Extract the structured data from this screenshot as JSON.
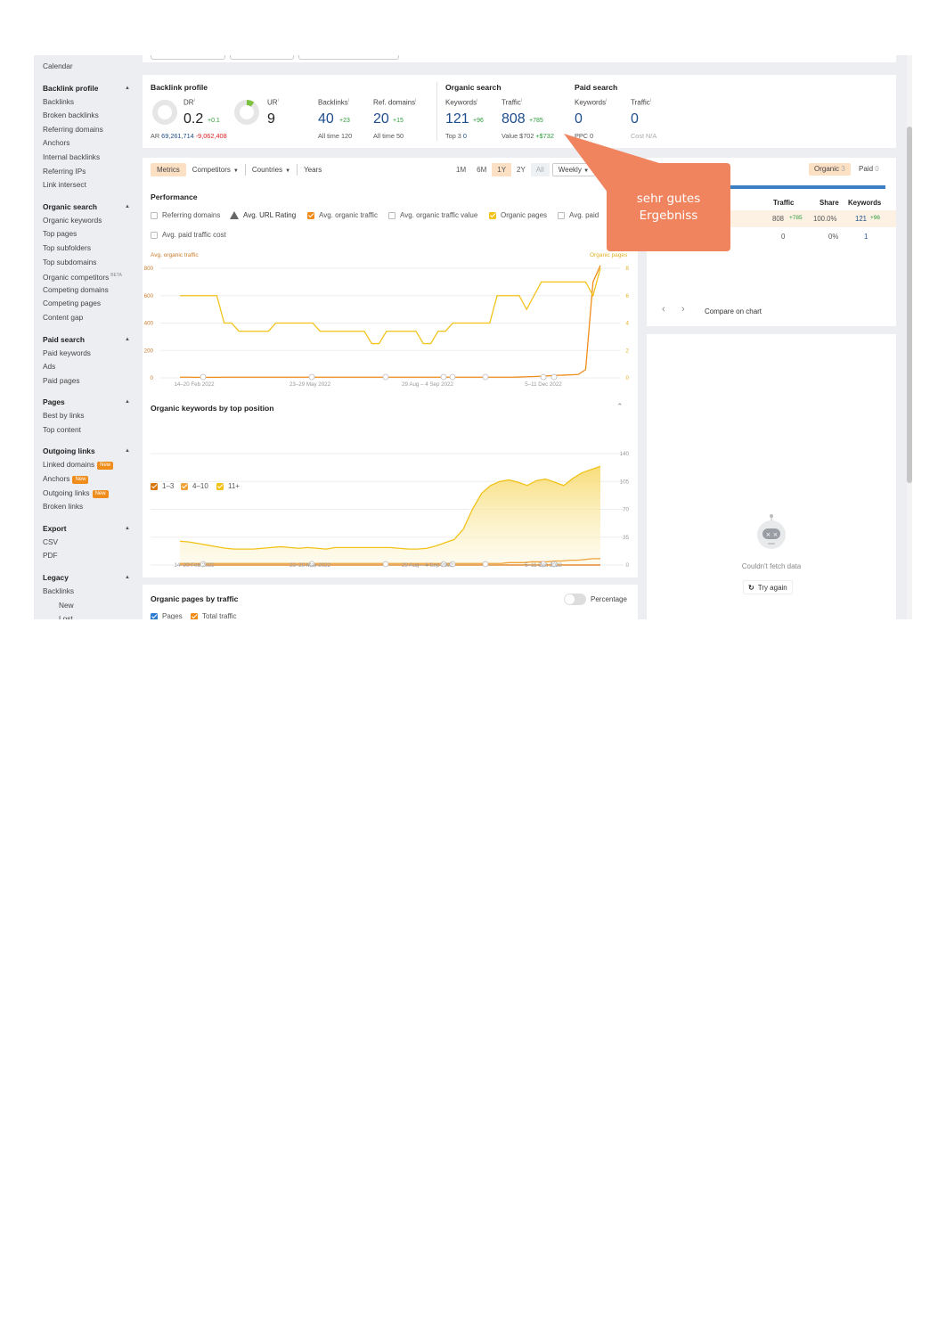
{
  "sidebar": {
    "top_item": "Calendar",
    "sections": [
      {
        "title": "Backlink profile",
        "items": [
          "Backlinks",
          "Broken backlinks",
          "Referring domains",
          "Anchors",
          "Internal backlinks",
          "Referring IPs",
          "Link intersect"
        ]
      },
      {
        "title": "Organic search",
        "items": [
          "Organic keywords",
          "Top pages",
          "Top subfolders",
          "Top subdomains",
          "Organic competitors",
          "Competing domains",
          "Competing pages",
          "Content gap"
        ],
        "beta_item": "Organic competitors",
        "beta_label": "BETA"
      },
      {
        "title": "Paid search",
        "items": [
          "Paid keywords",
          "Ads",
          "Paid pages"
        ]
      },
      {
        "title": "Pages",
        "items": [
          "Best by links",
          "Top content"
        ]
      },
      {
        "title": "Outgoing links",
        "items": [
          "Linked domains",
          "Anchors",
          "Outgoing links",
          "Broken links"
        ],
        "new_items": [
          "Linked domains",
          "Anchors",
          "Outgoing links"
        ],
        "new_label": "New"
      },
      {
        "title": "Export",
        "items": [
          "CSV",
          "PDF"
        ]
      },
      {
        "title": "Legacy",
        "items": [
          "Backlinks"
        ],
        "sub_items": [
          "New",
          "Lost"
        ]
      }
    ]
  },
  "metrics": {
    "backlink_profile": {
      "title": "Backlink profile",
      "dr": {
        "label": "DR",
        "value": "0.2",
        "delta": "+0.1",
        "ar_label": "AR",
        "ar_value": "69,261,714",
        "ar_delta": "-9,062,408",
        "ring_fill": 0.0
      },
      "ur": {
        "label": "UR",
        "value": "9",
        "ring_fill": 0.09
      },
      "backlinks": {
        "label": "Backlinks",
        "value": "40",
        "delta": "+23",
        "sub": "All time 120"
      },
      "ref_domains": {
        "label": "Ref. domains",
        "value": "20",
        "delta": "+15",
        "sub": "All time 50"
      }
    },
    "organic_search": {
      "title": "Organic search",
      "keywords": {
        "label": "Keywords",
        "value": "121",
        "delta": "+96",
        "sub_label": "Top 3",
        "sub_value": "0"
      },
      "traffic": {
        "label": "Traffic",
        "value": "808",
        "delta": "+785",
        "sub_label": "Value",
        "sub_value": "$702",
        "sub_delta": "+$732"
      }
    },
    "paid_search": {
      "title": "Paid search",
      "keywords": {
        "label": "Keywords",
        "value": "0",
        "sub": "PPC 0"
      },
      "traffic": {
        "label": "Traffic",
        "value": "0",
        "sub": "Cost N/A"
      }
    }
  },
  "performance": {
    "tabs": [
      "Metrics",
      "Competitors",
      "Countries",
      "Years"
    ],
    "ranges": [
      "1M",
      "6M",
      "1Y",
      "2Y",
      "All"
    ],
    "active_range": "1Y",
    "interval": "Weekly",
    "title": "Performance",
    "checks": [
      {
        "label": "Referring domains",
        "on": false,
        "color": ""
      },
      {
        "label": "Avg. URL Rating",
        "on": false,
        "color": "",
        "warn": true
      },
      {
        "label": "Avg. organic traffic",
        "on": true,
        "color": "#ef8c1a"
      },
      {
        "label": "Avg. organic traffic value",
        "on": false,
        "color": ""
      },
      {
        "label": "Organic pages",
        "on": true,
        "color": "#f2c218"
      },
      {
        "label": "Avg. paid",
        "on": false,
        "color": ""
      },
      {
        "label": "Avg. paid traffic cost",
        "on": false,
        "color": ""
      }
    ],
    "left_axis_label": "Avg. organic traffic",
    "right_axis_label": "Organic pages",
    "left_ticks": [
      "800",
      "600",
      "400",
      "200",
      "0"
    ],
    "right_ticks": [
      "8",
      "6",
      "4",
      "2",
      "0"
    ],
    "x_ticks": [
      "14–20 Feb 2022",
      "23–29 May 2022",
      "29 Aug – 4 Sep 2022",
      "5–11 Dec 2022"
    ]
  },
  "chart_data": [
    {
      "type": "line",
      "title": "Performance",
      "series": [
        {
          "name": "Avg. organic traffic",
          "axis": "left",
          "color": "#ef8c1a",
          "values": [
            5,
            5,
            4,
            4,
            4,
            4,
            5,
            5,
            5,
            5,
            5,
            5,
            5,
            5,
            5,
            5,
            5,
            5,
            5,
            5,
            5,
            5,
            5,
            5,
            5,
            5,
            5,
            5,
            5,
            5,
            5,
            5,
            5,
            5,
            5,
            5,
            5,
            5,
            5,
            5,
            5,
            5,
            5,
            5,
            5,
            5,
            6,
            8,
            10,
            12,
            15,
            18,
            20,
            22,
            25,
            60,
            700,
            820
          ]
        },
        {
          "name": "Organic pages",
          "axis": "right",
          "color": "#f2c218",
          "values": [
            6,
            6,
            6,
            6,
            6,
            6,
            4,
            4,
            3.4,
            3.4,
            3.4,
            3.4,
            3.4,
            4,
            4,
            4,
            4,
            4,
            4,
            3.4,
            3.4,
            3.4,
            3.4,
            3.4,
            3.4,
            3.4,
            2.5,
            2.5,
            3.4,
            3.4,
            3.4,
            3.4,
            3.4,
            2.5,
            2.5,
            3.4,
            3.4,
            4,
            4,
            4,
            4,
            4,
            4,
            6,
            6,
            6,
            6,
            5,
            6,
            7,
            7,
            7,
            7,
            7,
            7,
            7,
            6,
            8
          ]
        }
      ],
      "ylim_left": [
        0,
        800
      ],
      "ylim_right": [
        0,
        8
      ]
    },
    {
      "type": "area",
      "title": "Organic keywords by top position",
      "series": [
        {
          "name": "1–3",
          "color": "#d9780e",
          "values": [
            0,
            0,
            0,
            0,
            0,
            0,
            0,
            0,
            0,
            0,
            0,
            0,
            0,
            0,
            0,
            0,
            0,
            0,
            0,
            0,
            0,
            0,
            0,
            0,
            0,
            0,
            0,
            0,
            0,
            0,
            0,
            0,
            0,
            0,
            0,
            0,
            0,
            0,
            0,
            0,
            0,
            0,
            0,
            0,
            0,
            0,
            0,
            0,
            0,
            0,
            0,
            0,
            0,
            0,
            0,
            0
          ]
        },
        {
          "name": "4–10",
          "color": "#f0a23b",
          "values": [
            2,
            2,
            2,
            2,
            2,
            2,
            2,
            2,
            2,
            2,
            2,
            2,
            2,
            2,
            2,
            2,
            2,
            2,
            2,
            2,
            2,
            2,
            2,
            2,
            2,
            2,
            2,
            2,
            2,
            2,
            2,
            2,
            2,
            2,
            2,
            2,
            2,
            2,
            2,
            2,
            2,
            2,
            2,
            3,
            3,
            3,
            4,
            4,
            4,
            5,
            5,
            6,
            6,
            7,
            8,
            8
          ]
        },
        {
          "name": "11–20",
          "color": "#f2c218",
          "values": [
            30,
            29,
            27,
            25,
            23,
            21,
            20,
            20,
            20,
            21,
            22,
            23,
            22,
            21,
            22,
            21,
            20,
            22,
            22,
            22,
            22,
            22,
            22,
            22,
            21,
            20,
            20,
            21,
            24,
            28,
            32,
            45,
            70,
            90,
            100,
            105,
            107,
            104,
            100,
            106,
            108,
            104,
            100,
            109,
            116,
            120,
            124
          ]
        }
      ],
      "y_ticks": [
        "140",
        "105",
        "70",
        "35",
        "0"
      ]
    }
  ],
  "keywords_chart": {
    "title": "Organic keywords by top position",
    "legend": [
      {
        "label": "1–3",
        "color": "#d9780e"
      },
      {
        "label": "4–10",
        "color": "#f0a23b"
      },
      {
        "label": "11+",
        "color": "#f2c218"
      }
    ],
    "y_ticks": [
      "140",
      "105",
      "70",
      "35",
      "0"
    ],
    "x_ticks": [
      "14–20 Feb 2022",
      "23–29 May 2022",
      "29 Aug – 4 Sep 2022",
      "5–11 Dec 2022"
    ]
  },
  "share": {
    "seg_organic": "Organic",
    "seg_organic_count": "3",
    "seg_paid": "Paid",
    "seg_paid_count": "0",
    "headers": [
      "Traffic",
      "Share",
      "Keywords"
    ],
    "rows": [
      {
        "traffic": "808",
        "traffic_delta": "+785",
        "share": "100.0%",
        "keywords": "121",
        "keywords_delta": "+96"
      },
      {
        "traffic": "0",
        "traffic_delta": "",
        "share": "0%",
        "keywords": "1",
        "keywords_delta": ""
      }
    ],
    "compare_label": "Compare on chart"
  },
  "fetch_error": {
    "message": "Couldn't fetch data",
    "retry_label": "Try again"
  },
  "organic_pages": {
    "title": "Organic pages by traffic",
    "toggle_label": "Percentage",
    "legend": [
      {
        "label": "Pages",
        "color": "#2f7bd0"
      },
      {
        "label": "Total traffic",
        "color": "#ef8c1a"
      }
    ]
  },
  "callout": {
    "line1": "sehr gutes",
    "line2": "Ergebniss",
    "color": "#f0845f"
  }
}
